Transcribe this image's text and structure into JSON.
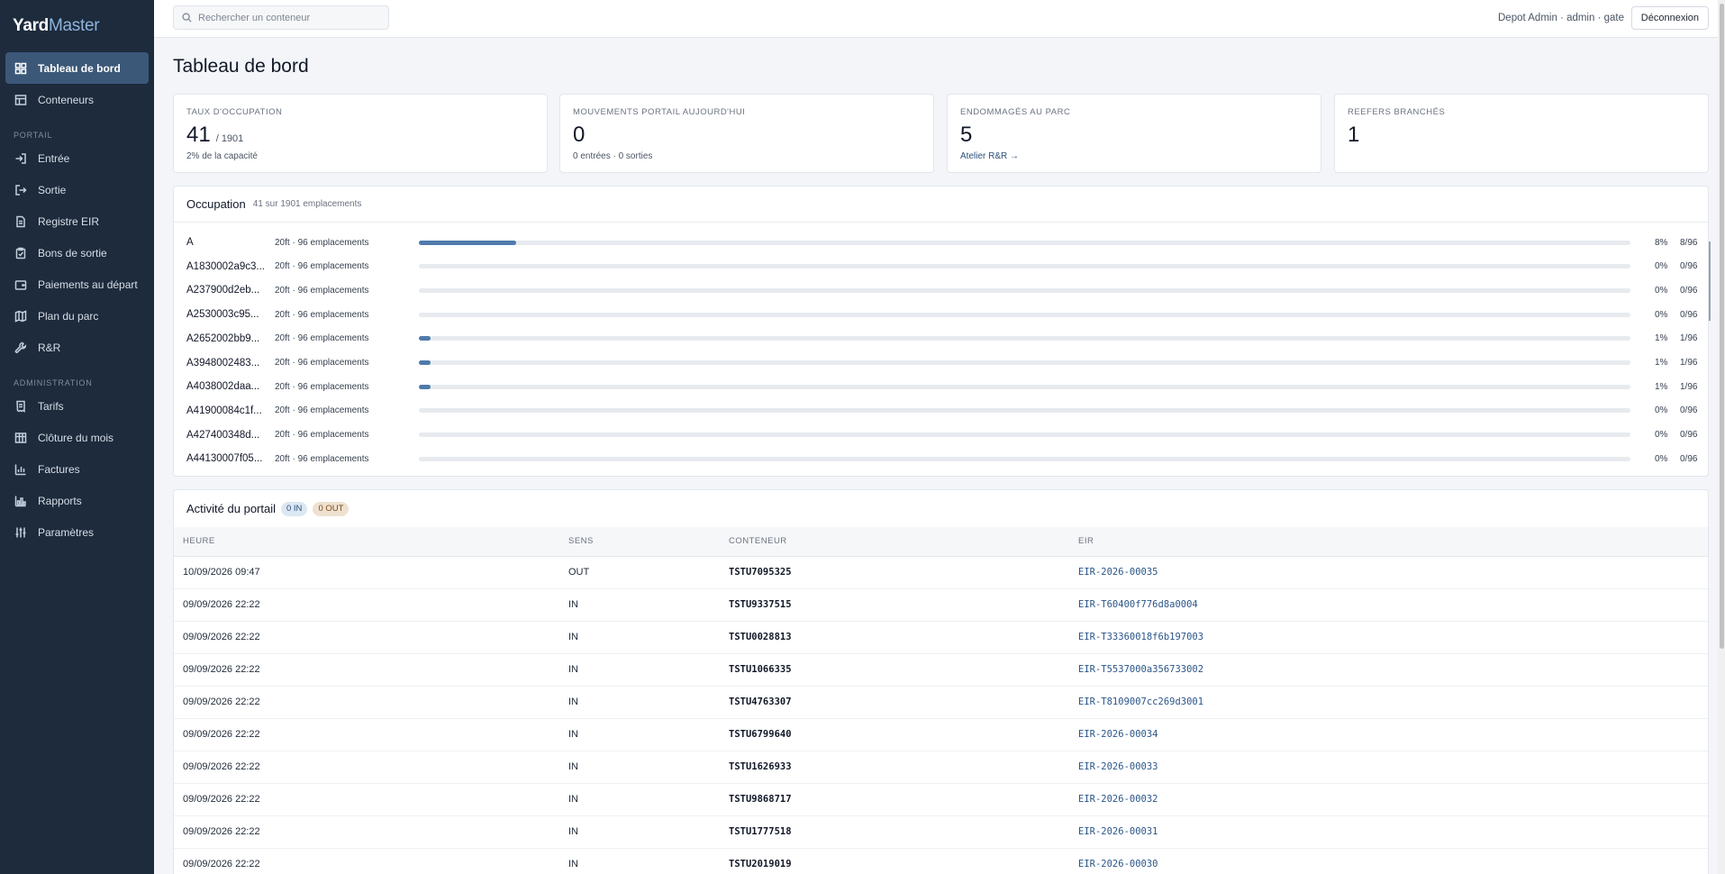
{
  "brand": {
    "part1": "Yard",
    "part2": "Master"
  },
  "nav": {
    "main": [
      {
        "id": "dashboard",
        "label": "Tableau de bord",
        "icon": "grid-icon",
        "active": true
      },
      {
        "id": "containers",
        "label": "Conteneurs",
        "icon": "table-icon",
        "active": false
      }
    ],
    "portal_label": "PORTAIL",
    "portal": [
      {
        "id": "entry",
        "label": "Entrée",
        "icon": "sign-in-icon"
      },
      {
        "id": "exit",
        "label": "Sortie",
        "icon": "sign-out-icon"
      },
      {
        "id": "eir",
        "label": "Registre EIR",
        "icon": "document-icon"
      },
      {
        "id": "release",
        "label": "Bons de sortie",
        "icon": "clipboard-icon"
      },
      {
        "id": "payments",
        "label": "Paiements au départ",
        "icon": "wallet-icon"
      },
      {
        "id": "yardplan",
        "label": "Plan du parc",
        "icon": "map-icon"
      },
      {
        "id": "rr",
        "label": "R&R",
        "icon": "wrench-icon"
      }
    ],
    "admin_label": "ADMINISTRATION",
    "admin": [
      {
        "id": "tariffs",
        "label": "Tarifs",
        "icon": "receipt-icon"
      },
      {
        "id": "monthclose",
        "label": "Clôture du mois",
        "icon": "calendar-grid-icon"
      },
      {
        "id": "invoices",
        "label": "Factures",
        "icon": "bar-chart-icon"
      },
      {
        "id": "reports",
        "label": "Rapports",
        "icon": "chart-icon"
      },
      {
        "id": "settings",
        "label": "Paramètres",
        "icon": "sliders-icon"
      }
    ]
  },
  "topbar": {
    "search_placeholder": "Rechercher un conteneur",
    "user": "Depot Admin · admin · gate",
    "logout": "Déconnexion"
  },
  "page": {
    "title": "Tableau de bord"
  },
  "stats": {
    "occupancy": {
      "label": "TAUX D'OCCUPATION",
      "value": "41",
      "total": "/ 1901",
      "sub": "2% de la capacité"
    },
    "gate_moves": {
      "label": "MOUVEMENTS PORTAIL AUJOURD'HUI",
      "value": "0",
      "sub": "0 entrées · 0 sorties"
    },
    "damaged": {
      "label": "ENDOMMAGÉS AU PARC",
      "value": "5",
      "link": "Atelier R&R →"
    },
    "reefers": {
      "label": "REEFERS BRANCHÉS",
      "value": "1"
    }
  },
  "occupation": {
    "title": "Occupation",
    "subtitle": "41 sur 1901 emplacements",
    "rows": [
      {
        "name": "A",
        "desc": "20ft · 96 emplacements",
        "fraction": 0.08,
        "pct": "8%",
        "count": "8/96"
      },
      {
        "name": "A1830002a9c3...",
        "desc": "20ft · 96 emplacements",
        "fraction": 0,
        "pct": "0%",
        "count": "0/96"
      },
      {
        "name": "A237900d2eb...",
        "desc": "20ft · 96 emplacements",
        "fraction": 0,
        "pct": "0%",
        "count": "0/96"
      },
      {
        "name": "A2530003c95...",
        "desc": "20ft · 96 emplacements",
        "fraction": 0,
        "pct": "0%",
        "count": "0/96"
      },
      {
        "name": "A2652002bb9...",
        "desc": "20ft · 96 emplacements",
        "fraction": 0.01,
        "pct": "1%",
        "count": "1/96"
      },
      {
        "name": "A3948002483...",
        "desc": "20ft · 96 emplacements",
        "fraction": 0.01,
        "pct": "1%",
        "count": "1/96"
      },
      {
        "name": "A4038002daa...",
        "desc": "20ft · 96 emplacements",
        "fraction": 0.01,
        "pct": "1%",
        "count": "1/96"
      },
      {
        "name": "A41900084c1f...",
        "desc": "20ft · 96 emplacements",
        "fraction": 0,
        "pct": "0%",
        "count": "0/96"
      },
      {
        "name": "A427400348d...",
        "desc": "20ft · 96 emplacements",
        "fraction": 0,
        "pct": "0%",
        "count": "0/96"
      },
      {
        "name": "A44130007f05...",
        "desc": "20ft · 96 emplacements",
        "fraction": 0,
        "pct": "0%",
        "count": "0/96"
      }
    ]
  },
  "activity": {
    "title": "Activité du portail",
    "badge_in": "0 IN",
    "badge_out": "0 OUT",
    "columns": [
      "HEURE",
      "SENS",
      "CONTENEUR",
      "EIR"
    ],
    "rows": [
      {
        "time": "10/09/2026 09:47",
        "dir": "OUT",
        "container": "TSTU7095325",
        "eir": "EIR-2026-00035"
      },
      {
        "time": "09/09/2026 22:22",
        "dir": "IN",
        "container": "TSTU9337515",
        "eir": "EIR-T60400f776d8a0004"
      },
      {
        "time": "09/09/2026 22:22",
        "dir": "IN",
        "container": "TSTU0028813",
        "eir": "EIR-T33360018f6b197003"
      },
      {
        "time": "09/09/2026 22:22",
        "dir": "IN",
        "container": "TSTU1066335",
        "eir": "EIR-T5537000a356733002"
      },
      {
        "time": "09/09/2026 22:22",
        "dir": "IN",
        "container": "TSTU4763307",
        "eir": "EIR-T8109007cc269d3001"
      },
      {
        "time": "09/09/2026 22:22",
        "dir": "IN",
        "container": "TSTU6799640",
        "eir": "EIR-2026-00034"
      },
      {
        "time": "09/09/2026 22:22",
        "dir": "IN",
        "container": "TSTU1626933",
        "eir": "EIR-2026-00033"
      },
      {
        "time": "09/09/2026 22:22",
        "dir": "IN",
        "container": "TSTU9868717",
        "eir": "EIR-2026-00032"
      },
      {
        "time": "09/09/2026 22:22",
        "dir": "IN",
        "container": "TSTU1777518",
        "eir": "EIR-2026-00031"
      },
      {
        "time": "09/09/2026 22:22",
        "dir": "IN",
        "container": "TSTU2019019",
        "eir": "EIR-2026-00030"
      }
    ]
  }
}
